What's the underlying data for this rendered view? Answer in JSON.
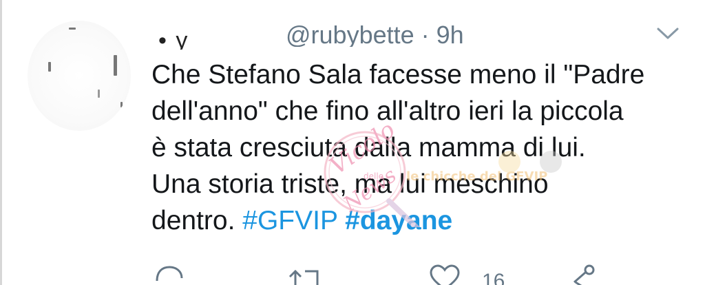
{
  "tweet": {
    "display_name": "• y",
    "handle_time": "@rubybette · 9h",
    "text_lines": [
      "Che Stefano Sala facesse meno il \"Padre",
      "dell'anno\" che fino all'altro ieri la piccola",
      "è stata cresciuta dalla mamma di lui.",
      "Una storia triste, ma lui meschino",
      "dentro. "
    ],
    "hashtags": [
      "#GFVIP",
      "#dayane"
    ]
  },
  "watermark": {
    "text_top": "Vicolo",
    "text_mid": "delle",
    "text_bottom": "News",
    "banner": "le chicche del GFVIP"
  },
  "actions": {
    "reply_icon": "reply-icon",
    "retweet_icon": "retweet-icon",
    "like_icon": "heart-icon",
    "like_count": "16",
    "share_icon": "share-icon"
  },
  "colors": {
    "hashtag": "#1b95e0",
    "muted": "#657786",
    "text": "#14171a"
  }
}
